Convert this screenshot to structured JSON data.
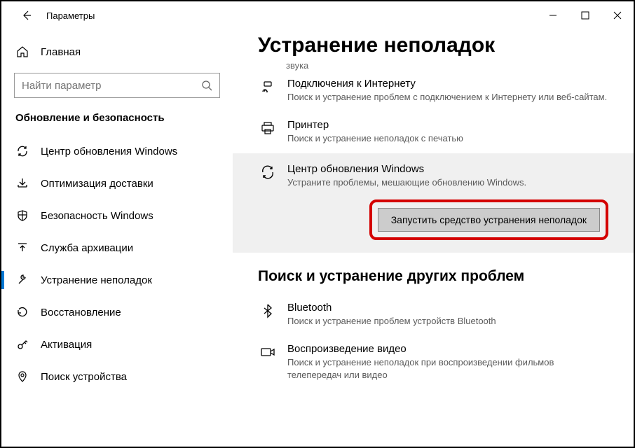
{
  "window": {
    "app_title": "Параметры"
  },
  "sidebar": {
    "home": "Главная",
    "search_placeholder": "Найти параметр",
    "section": "Обновление и безопасность",
    "items": [
      {
        "label": "Центр обновления Windows"
      },
      {
        "label": "Оптимизация доставки"
      },
      {
        "label": "Безопасность Windows"
      },
      {
        "label": "Служба архивации"
      },
      {
        "label": "Устранение неполадок"
      },
      {
        "label": "Восстановление"
      },
      {
        "label": "Активация"
      },
      {
        "label": "Поиск устройства"
      }
    ]
  },
  "main": {
    "title": "Устранение неполадок",
    "truncated_top": "звука",
    "items": {
      "internet": {
        "title": "Подключения к Интернету",
        "desc": "Поиск и устранение проблем с подключением к Интернету или веб-сайтам."
      },
      "printer": {
        "title": "Принтер",
        "desc": "Поиск и устранение неполадок с печатью"
      },
      "update": {
        "title": "Центр обновления Windows",
        "desc": "Устраните проблемы, мешающие обновлению Windows.",
        "run_button": "Запустить средство устранения неполадок"
      }
    },
    "subheading": "Поиск и устранение других проблем",
    "extra": {
      "bluetooth": {
        "title": "Bluetooth",
        "desc": "Поиск и устранение проблем устройств Bluetooth"
      },
      "video": {
        "title": "Воспроизведение видео",
        "desc": "Поиск и устранение неполадок при воспроизведении фильмов телепередач или видео"
      }
    }
  }
}
